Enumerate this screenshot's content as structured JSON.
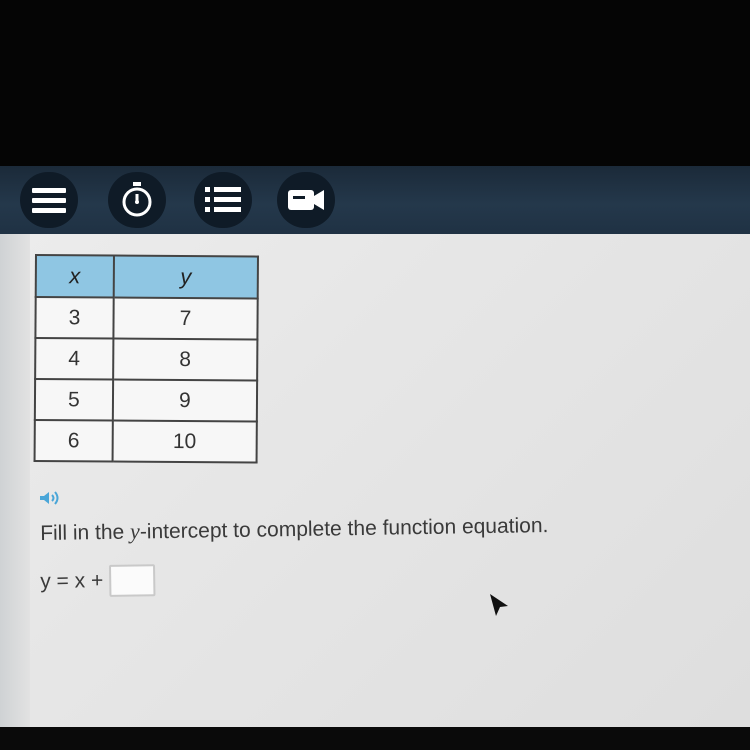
{
  "toolbar": {
    "buttons": [
      {
        "name": "menu",
        "icon": "hamburger-menu-icon"
      },
      {
        "name": "timer",
        "icon": "stopwatch-icon"
      },
      {
        "name": "list",
        "icon": "list-icon"
      },
      {
        "name": "video",
        "icon": "video-camera-icon"
      }
    ],
    "colors": {
      "bar": "#24384b",
      "button": "#0f1b27",
      "icon": "#ffffff"
    }
  },
  "table": {
    "headers": [
      "x",
      "y"
    ],
    "rows": [
      [
        "3",
        "7"
      ],
      [
        "4",
        "8"
      ],
      [
        "5",
        "9"
      ],
      [
        "6",
        "10"
      ]
    ],
    "colors": {
      "header": "#8fc6e3"
    }
  },
  "question": {
    "audio_icon": "speaker-icon",
    "prompt_before": "Fill in the ",
    "prompt_var": "y",
    "prompt_after": "-intercept to complete the function equation.",
    "equation": "y = x +",
    "answer_value": ""
  }
}
